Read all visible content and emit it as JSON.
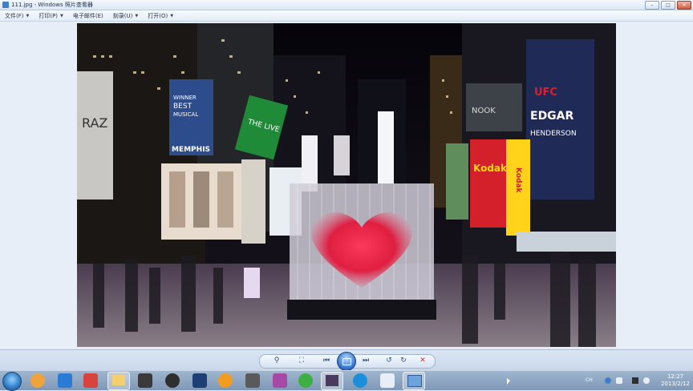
{
  "window": {
    "title": "111.jpg - Windows 照片查看器",
    "controls": {
      "minimize": "–",
      "maximize": "□",
      "close": "✕"
    }
  },
  "menu": [
    {
      "label": "文件(F)"
    },
    {
      "label": "打印(P)"
    },
    {
      "label": "电子邮件(E)"
    },
    {
      "label": "刻录(U)"
    },
    {
      "label": "打开(O)"
    }
  ],
  "photo": {
    "signs": [
      "WINNER BEST MUSICAL",
      "MEMPHIS",
      "THE LIVE",
      "UFC",
      "EDGAR",
      "HENDERSON",
      "Kodak",
      "Kodak",
      "NOOK",
      "RAZ"
    ],
    "colors": {
      "heart": "#ff2a4a",
      "sky": "#0b0a10"
    }
  },
  "toolbar": {
    "icons": [
      "magnifier-icon",
      "fit-window-icon",
      "previous-icon",
      "slideshow-icon",
      "next-icon",
      "rotate-left-icon",
      "rotate-right-icon",
      "delete-icon"
    ]
  },
  "taskbar": {
    "tray_label": "CH",
    "time": "12:27",
    "date": "2013/2/12"
  }
}
